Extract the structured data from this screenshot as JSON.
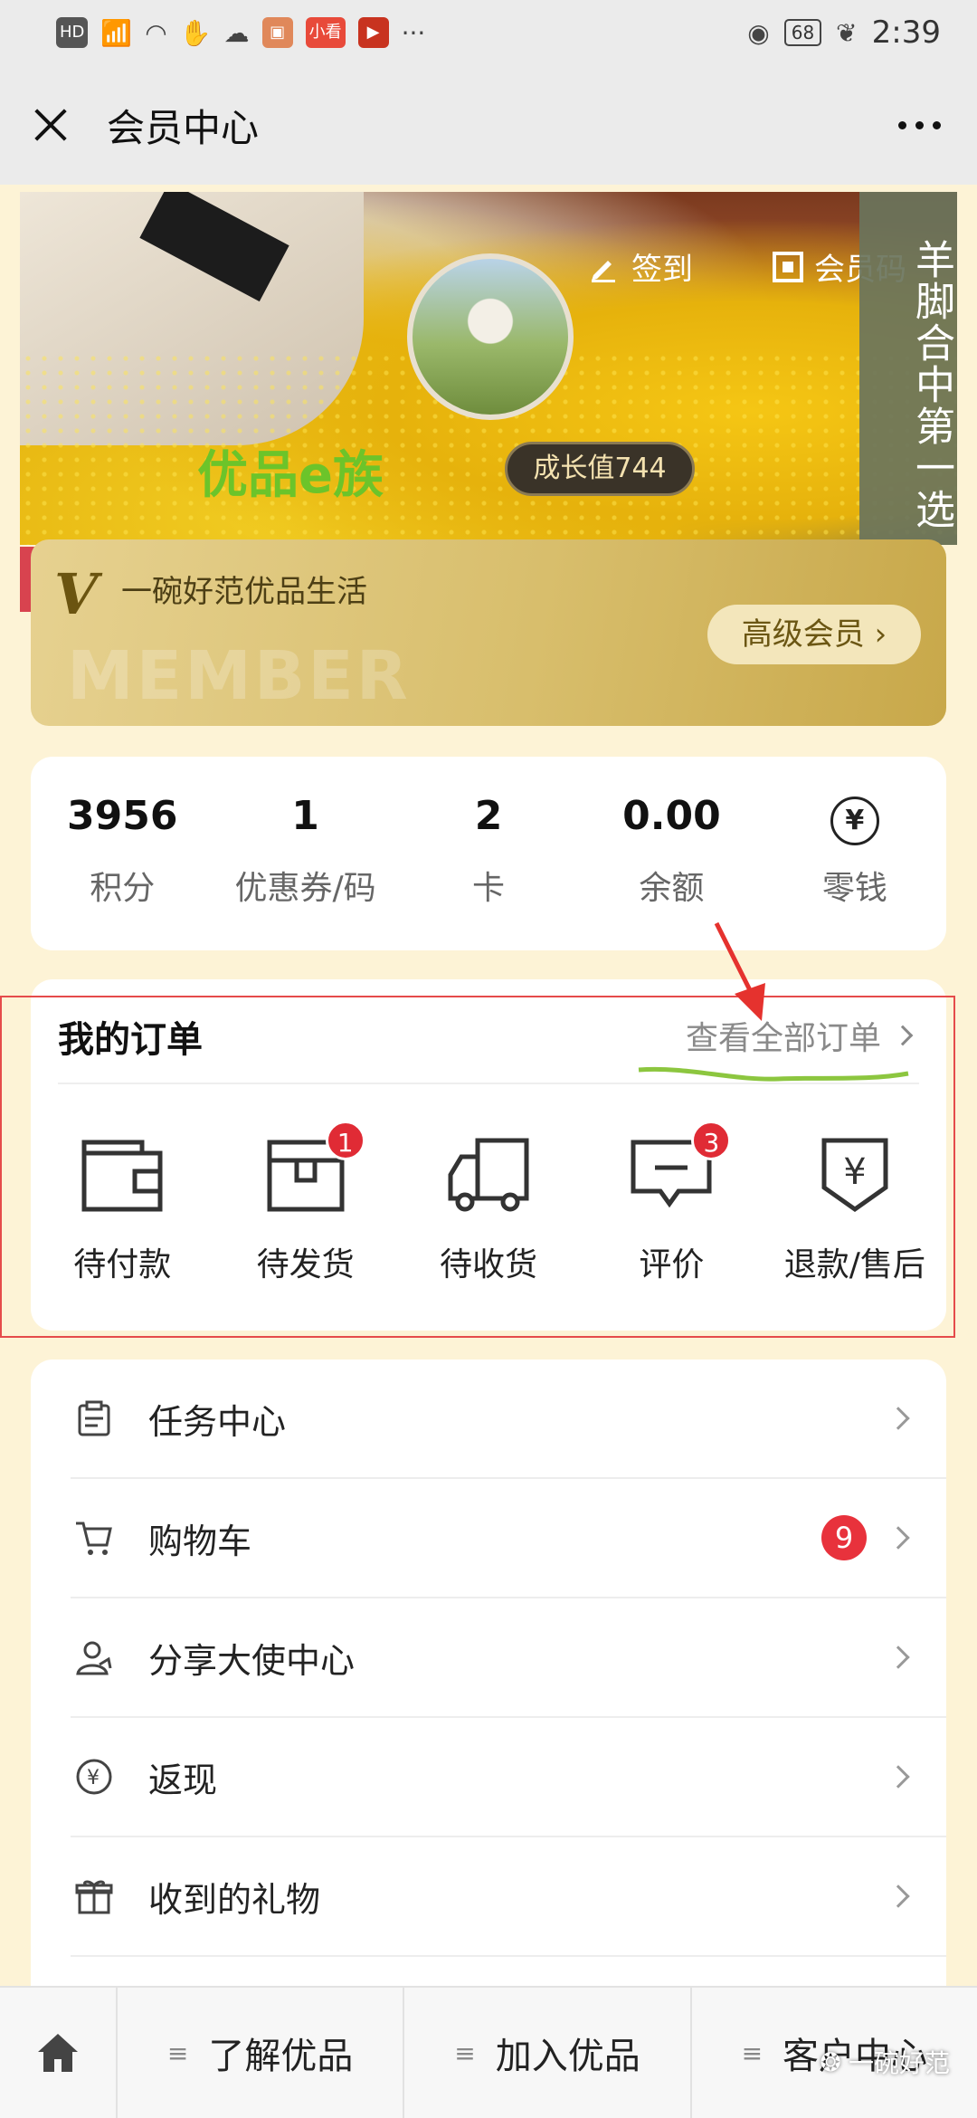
{
  "status_bar": {
    "left_items": [
      "HD",
      "4G",
      "wifi",
      "hand",
      "cloud",
      "app1",
      "小看",
      "app3",
      "···"
    ],
    "battery": "68",
    "time": "2:39"
  },
  "nav": {
    "title": "会员中心"
  },
  "hero": {
    "checkin_label": "签到",
    "member_code_label": "会员码",
    "user_name": "优品e族",
    "growth": "成长值744",
    "side_slogan": "羊脚合中第一选"
  },
  "member_card": {
    "slogan": "一碗好范优品生活",
    "watermark": "MEMBER",
    "level": "高级会员 ›"
  },
  "stats": [
    {
      "value": "3956",
      "label": "积分"
    },
    {
      "value": "1",
      "label": "优惠券/码"
    },
    {
      "value": "2",
      "label": "卡"
    },
    {
      "value": "0.00",
      "label": "余额"
    },
    {
      "value": "¥",
      "label": "零钱"
    }
  ],
  "orders": {
    "title": "我的订单",
    "view_all": "查看全部订单",
    "items": [
      {
        "label": "待付款",
        "badge": ""
      },
      {
        "label": "待发货",
        "badge": "1"
      },
      {
        "label": "待收货",
        "badge": ""
      },
      {
        "label": "评价",
        "badge": "3"
      },
      {
        "label": "退款/售后",
        "badge": ""
      }
    ]
  },
  "menu": [
    {
      "label": "任务中心",
      "badge": ""
    },
    {
      "label": "购物车",
      "badge": "9"
    },
    {
      "label": "分享大使中心",
      "badge": ""
    },
    {
      "label": "返现",
      "badge": ""
    },
    {
      "label": "收到的礼物",
      "badge": ""
    }
  ],
  "bottom_bar": {
    "tabs": [
      "了解优品",
      "加入优品",
      "客户中心"
    ],
    "watermark": "一碗好范"
  },
  "colors": {
    "accent_green": "#6cc42a",
    "badge_red": "#e02b35",
    "gold": "#d8be6c",
    "annotation_red": "#e54b4b"
  }
}
